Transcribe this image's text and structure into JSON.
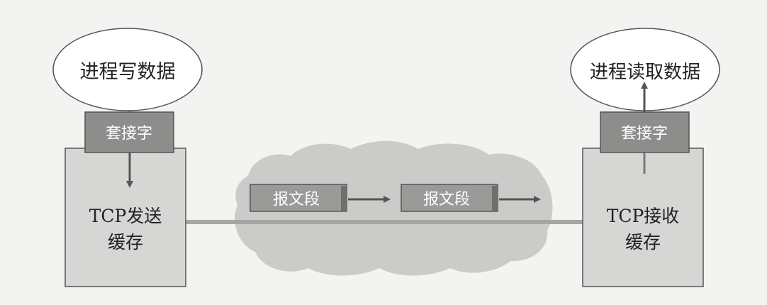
{
  "left": {
    "process_label": "进程写数据",
    "socket_label": "套接字",
    "buffer_line1": "TCP发送",
    "buffer_line2": "缓存"
  },
  "right": {
    "process_label": "进程读取数据",
    "socket_label": "套接字",
    "buffer_line1": "TCP接收",
    "buffer_line2": "缓存"
  },
  "network": {
    "segments": [
      {
        "label": "报文段"
      },
      {
        "label": "报文段"
      }
    ]
  },
  "colors": {
    "buffer_fill": "#d6d6d4",
    "socket_fill": "#8d8d8b",
    "cloud_fill": "#cbcbc9",
    "segment_fill": "#9a9a98",
    "line": "#555555",
    "link": "#a6a6a4"
  }
}
